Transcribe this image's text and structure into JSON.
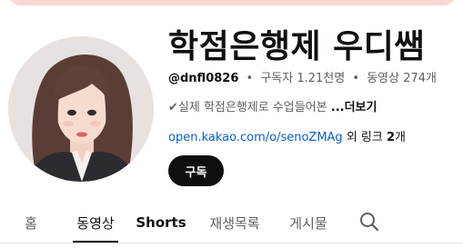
{
  "channel": {
    "name": "학점은행제 우디쌤",
    "handle": "@dnfl0826",
    "subscribers": "구독자 1.21천명",
    "videos": "동영상 274개",
    "description": "✔실제 학점은행제로 수업들어본 ",
    "more_label": "...더보기",
    "link_url": "open.kakao.com/o/senoZMAg",
    "link_suffix_pre": " 외 링크 ",
    "link_count": "2",
    "link_suffix_post": "개",
    "subscribe_label": "구독"
  },
  "tabs": [
    {
      "label": "홈",
      "active": false
    },
    {
      "label": "동영상",
      "active": true
    },
    {
      "label": "Shorts",
      "active": false
    },
    {
      "label": "재생목록",
      "active": false
    },
    {
      "label": "게시물",
      "active": false
    }
  ],
  "icons": {
    "search": "search-icon"
  },
  "colors": {
    "banner": "#fbd9d2",
    "link": "#065fd4",
    "subscribe_bg": "#0f0f0f",
    "secondary_text": "#606060"
  }
}
